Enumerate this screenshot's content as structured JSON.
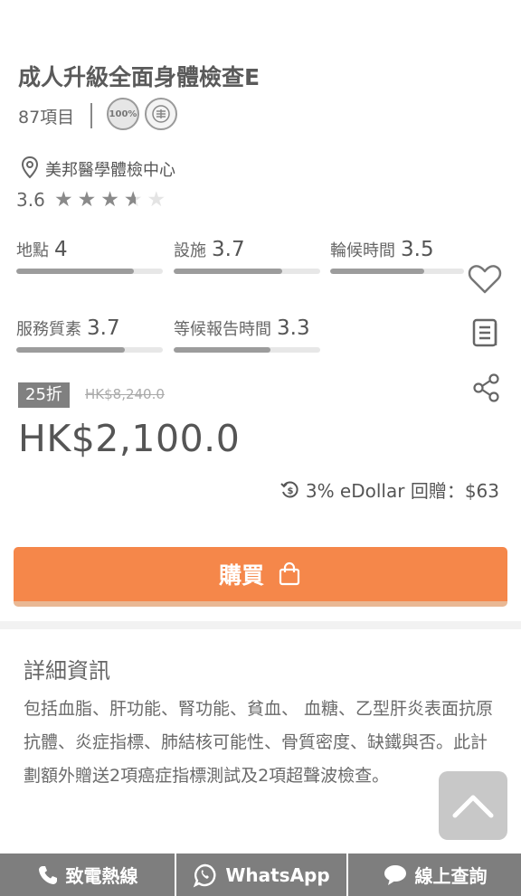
{
  "product": {
    "title": "成人升級全面身體檢查E",
    "item_count": "87項目",
    "badges": [
      "100%",
      "🈯"
    ]
  },
  "center": {
    "name": "美邦醫學體檢中心",
    "rating": "3.6",
    "stars": 3.5
  },
  "metrics": [
    {
      "label": "地點",
      "value": "4",
      "fraction": 0.8
    },
    {
      "label": "設施",
      "value": "3.7",
      "fraction": 0.74
    },
    {
      "label": "輪候時間",
      "value": "3.5",
      "fraction": 0.7
    },
    {
      "label": "服務質素",
      "value": "3.7",
      "fraction": 0.74
    },
    {
      "label": "等候報告時間",
      "value": "3.3",
      "fraction": 0.66
    }
  ],
  "pricing": {
    "discount": "25折",
    "original": "HK$8,240.0",
    "price": "HK$2,100.0",
    "edollar": "3% eDollar 回贈：$63"
  },
  "buy_label": "購買",
  "details": {
    "title": "詳細資訊",
    "text": "包括血脂、肝功能、腎功能、貧血、 血糖、乙型肝炎表面抗原抗體、炎症指標、肺結核可能性、骨質密度、缺鐵與否。此計劃額外贈送2項癌症指標測試及2項超聲波檢查。"
  },
  "bottom_bar": {
    "call": "致電熱線",
    "whatsapp": "WhatsApp",
    "online": "線上查詢"
  },
  "icons": [
    "location-pin-icon",
    "heart-icon",
    "document-icon",
    "share-icon",
    "cashback-icon",
    "shopping-bag-icon",
    "chevron-up-icon",
    "phone-icon",
    "whatsapp-icon",
    "chat-icon"
  ],
  "colors": {
    "accent": "#f5874a",
    "bar": "#7e7e7e"
  }
}
